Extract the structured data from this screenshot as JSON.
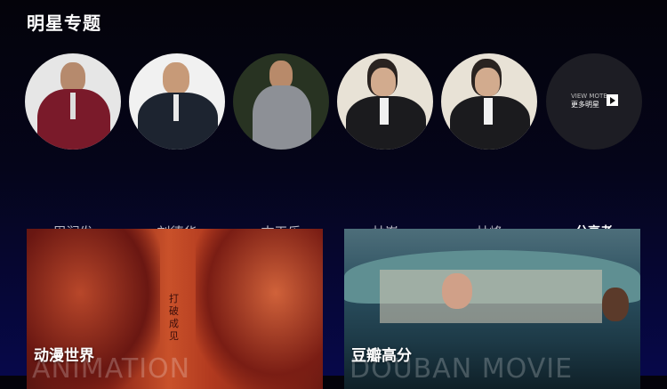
{
  "section": {
    "title": "明星专题"
  },
  "stars": [
    {
      "name": "周润发"
    },
    {
      "name": "刘德华"
    },
    {
      "name": "古天乐"
    },
    {
      "name": "林峯"
    },
    {
      "name": "林峰"
    }
  ],
  "more": {
    "en": "VIEW MOTE",
    "zh": "更多明星",
    "label": "分享者"
  },
  "cards": [
    {
      "title": "动漫世界",
      "subtitle": "ANIMATION",
      "poster_text": "打破成见"
    },
    {
      "title": "豆瓣高分",
      "subtitle": "DOUBAN MOVIE"
    }
  ],
  "colors": {
    "background_bottom": "#07084a",
    "name_text": "#b9b9c4"
  }
}
